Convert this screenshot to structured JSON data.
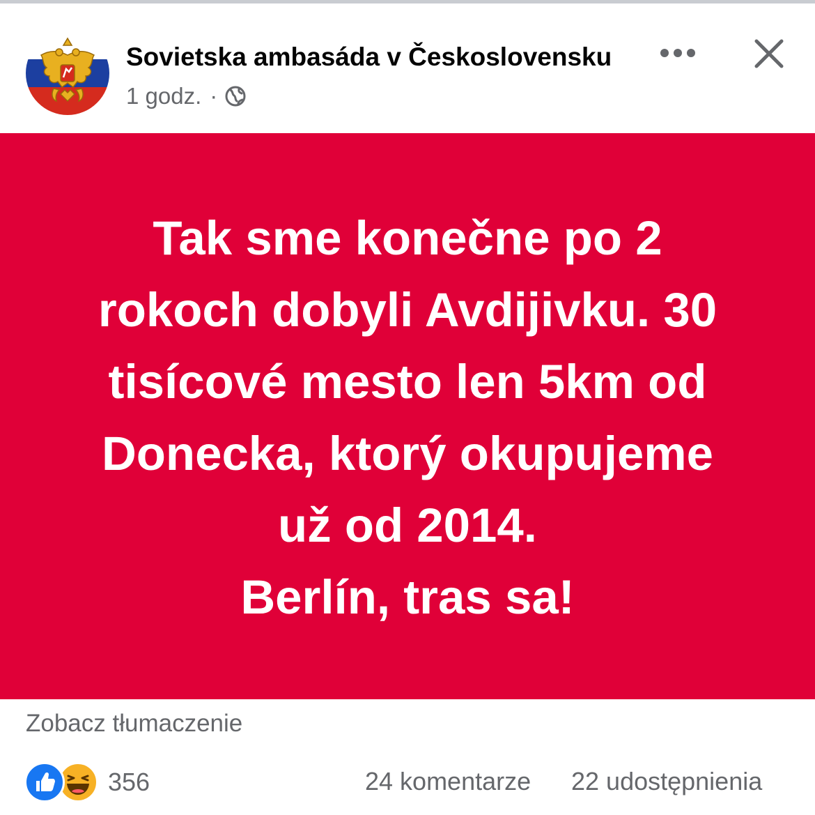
{
  "post": {
    "page_name": "Sovietska ambasáda v Československu",
    "time": "1 godz.",
    "separator": "·",
    "privacy_icon": "globe-icon",
    "avatar_icon": "russian-coat-of-arms-icon",
    "banner_color": "#e00038",
    "text": "Tak sme konečne po 2\nrokoch dobyli Avdijivku. 30\ntisícové mesto len 5km od\nDonecka, ktorý okupujeme\nuž od 2014.\nBerlín, tras sa!"
  },
  "actions": {
    "more_icon": "more-horizontal-icon",
    "close_icon": "close-icon",
    "translate_label": "Zobacz tłumaczenie"
  },
  "engagement": {
    "reaction_icons": [
      "like-icon",
      "haha-icon"
    ],
    "reaction_count": "356",
    "comments": "24 komentarze",
    "shares": "22 udostępnienia"
  }
}
